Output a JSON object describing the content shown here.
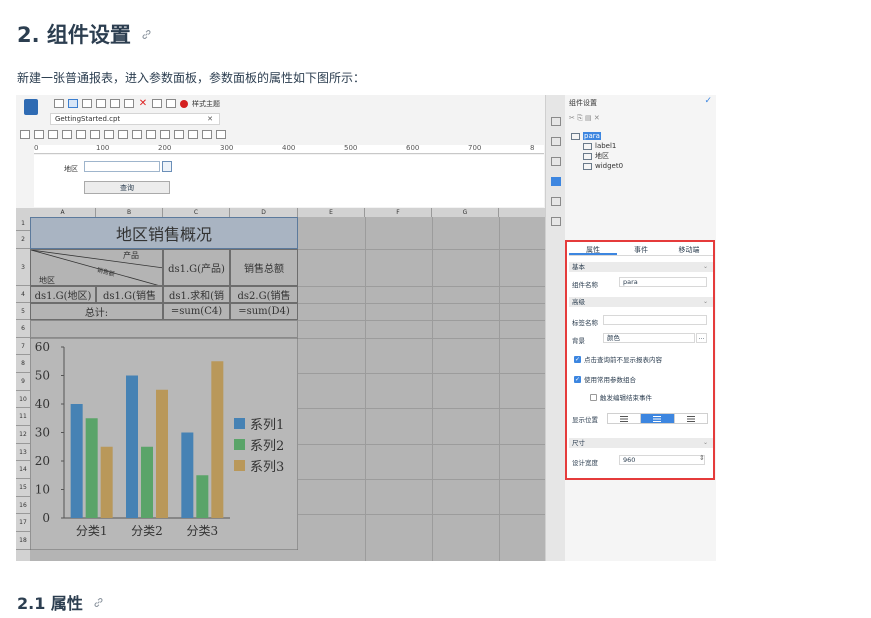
{
  "page": {
    "heading": "2. 组件设置",
    "intro": "新建一张普通报表，进入参数面板，参数面板的属性如下图所示：",
    "subheading": "2.1 属性"
  },
  "designer": {
    "toolbar_theme": "样式主题",
    "file_tab": "GettingStarted.cpt",
    "ruler_ticks": [
      "0",
      "100",
      "200",
      "300",
      "400",
      "500",
      "600",
      "700",
      "8"
    ],
    "param_label": "地区",
    "query_button": "查询",
    "columns": [
      "A",
      "B",
      "C",
      "D",
      "E",
      "F",
      "G"
    ],
    "rows": [
      "1",
      "2",
      "3",
      "4",
      "5",
      "6",
      "7",
      "8",
      "9",
      "10",
      "11",
      "12",
      "13",
      "14",
      "15",
      "16",
      "17",
      "18"
    ],
    "report": {
      "title": "地区销售概况",
      "header_product": "产品",
      "header_sales": "销售额",
      "header_region": "地区",
      "header_c3": "ds1.G(产品)",
      "header_d3": "销售总额",
      "row4": [
        "ds1.G(地区)",
        "ds1.G(销售",
        "ds1.求和(销",
        "ds2.G(销售"
      ],
      "total_label": "总计:",
      "total_c": "=sum(C4)",
      "total_d": "=sum(D4)"
    }
  },
  "chart_data": {
    "type": "bar",
    "categories": [
      "分类1",
      "分类2",
      "分类3"
    ],
    "series": [
      {
        "name": "系列1",
        "values": [
          40,
          50,
          30
        ],
        "color": "#4682b4"
      },
      {
        "name": "系列2",
        "values": [
          35,
          25,
          15
        ],
        "color": "#5aa469"
      },
      {
        "name": "系列3",
        "values": [
          25,
          45,
          55
        ],
        "color": "#b9985a"
      }
    ],
    "yticks": [
      "0",
      "10",
      "20",
      "30",
      "40",
      "50",
      "60"
    ],
    "ylim": [
      0,
      60
    ],
    "legend": "right"
  },
  "panel": {
    "title": "组件设置",
    "tree": [
      "para",
      "label1",
      "地区",
      "widget0"
    ],
    "tabs": [
      "属性",
      "事件",
      "移动端"
    ],
    "sec_basic": "基本",
    "name_label": "组件名称",
    "name_value": "para",
    "sec_advanced": "高级",
    "tag_label": "标签名称",
    "bg_label": "背景",
    "bg_value": "颜色",
    "bg_more": "...",
    "opt1": "点击查询前不显示报表内容",
    "opt2": "使用常用参数组合",
    "opt3": "触发编辑结束事件",
    "pos_label": "显示位置",
    "sec_size": "尺寸",
    "width_label": "设计宽度",
    "width_value": "960"
  }
}
